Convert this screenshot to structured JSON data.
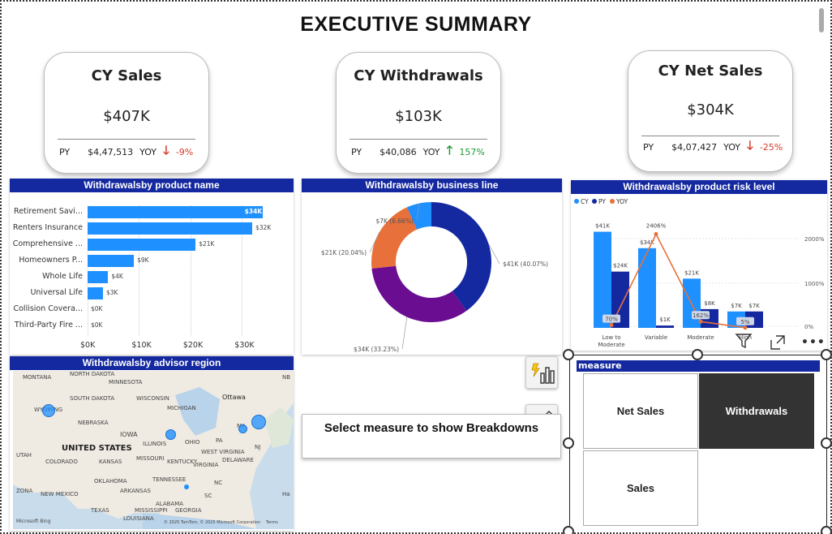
{
  "title": "EXECUTIVE SUMMARY",
  "kpis": [
    {
      "title": "CY Sales",
      "value": "$407K",
      "py_label": "PY",
      "py_value": "$4,47,513",
      "yoy_label": "YOY",
      "yoy": "-9%",
      "trend": "down"
    },
    {
      "title": "CY Withdrawals",
      "value": "$103K",
      "py_label": "PY",
      "py_value": "$40,086",
      "yoy_label": "YOY",
      "yoy": "157%",
      "trend": "up"
    },
    {
      "title": "CY Net Sales",
      "value": "$304K",
      "py_label": "PY",
      "py_value": "$4,07,427",
      "yoy_label": "YOY",
      "yoy": "-25%",
      "trend": "down"
    }
  ],
  "bar_panel": {
    "title": "Withdrawalsby product name",
    "x_ticks": [
      "$0K",
      "$10K",
      "$20K",
      "$30K"
    ]
  },
  "donut_panel": {
    "title": "Withdrawalsby business line"
  },
  "combo_panel": {
    "title": "Withdrawalsby product risk level",
    "legend": [
      "CY",
      "PY",
      "YOY"
    ],
    "right_ticks": [
      "2000%",
      "1000%",
      "0%"
    ]
  },
  "map_panel": {
    "title": "Withdrawalsby advisor region",
    "labels": [
      "MONTANA",
      "NORTH DAKOTA",
      "MINNESOTA",
      "SOUTH DAKOTA",
      "WYOMING",
      "WISCONSIN",
      "MICHIGAN",
      "Ottawa",
      "NEBRASKA",
      "IOWA",
      "UNITED STATES",
      "ILLINOIS",
      "OHIO",
      "PA",
      "NY",
      "NJ",
      "UTAH",
      "COLORADO",
      "KANSAS",
      "MISSOURI",
      "KENTUCKY",
      "WEST VIRGINIA",
      "DELAWARE",
      "VIRGINIA",
      "OKLAHOMA",
      "TENNESSEE",
      "NC",
      "ZONA",
      "NEW MEXICO",
      "ARKANSAS",
      "SC",
      "ALABAMA",
      "GEORGIA",
      "TEXAS",
      "MISSISSIPPI",
      "LOUISIANA",
      "NB",
      "Ha",
      "Microsoft Bing",
      "© 2025 TomTom, © 2025 Microsoft Corporation",
      "Terms"
    ]
  },
  "textbox": {
    "text": "Select measure to show Breakdowns"
  },
  "slicer": {
    "title": "measure",
    "options": [
      "Net Sales",
      "Withdrawals",
      "Sales"
    ],
    "selected": "Withdrawals"
  },
  "colors": {
    "header_blue": "#1428a0",
    "bar_blue": "#1e90ff",
    "navy": "#1428a0",
    "purple": "#6a0d91",
    "orange": "#e8703a",
    "yoy_orange": "#e8703a",
    "down": "#d43a2c",
    "up": "#1b9b36"
  },
  "chart_data": [
    {
      "type": "bar",
      "title": "Withdrawalsby product name",
      "categories": [
        "Retirement Savi...",
        "Renters Insurance",
        "Comprehensive ...",
        "Homeowners P...",
        "Whole Life",
        "Universal Life",
        "Collision Covera...",
        "Third-Party Fire ..."
      ],
      "values": [
        34,
        32,
        21,
        9,
        4,
        3,
        0,
        0
      ],
      "labels": [
        "$34K",
        "$32K",
        "$21K",
        "$9K",
        "$4K",
        "$3K",
        "$0K",
        "$0K"
      ],
      "xlim": [
        0,
        35
      ],
      "orientation": "horizontal"
    },
    {
      "type": "pie",
      "title": "Withdrawalsby business line",
      "slices": [
        {
          "label": "$41K (40.07%)",
          "value": 40.07,
          "color": "#1428a0"
        },
        {
          "label": "$34K (33.23%)",
          "value": 33.23,
          "color": "#6a0d91"
        },
        {
          "label": "$21K (20.04%)",
          "value": 20.04,
          "color": "#e8703a"
        },
        {
          "label": "$7K (6.66%)",
          "value": 6.66,
          "color": "#1e90ff"
        }
      ]
    },
    {
      "type": "bar",
      "title": "Withdrawalsby product risk level",
      "categories": [
        "Low to Moderate",
        "Variable",
        "Moderate",
        "High"
      ],
      "series": [
        {
          "name": "CY",
          "values": [
            41,
            34,
            21,
            7
          ],
          "labels": [
            "$41K",
            "$34K",
            "$21K",
            "$7K"
          ]
        },
        {
          "name": "PY",
          "values": [
            24,
            1,
            8,
            7
          ],
          "labels": [
            "$24K",
            "$1K",
            "$8K",
            "$7K"
          ]
        },
        {
          "name": "YOY",
          "values": [
            70,
            2406,
            162,
            5
          ],
          "labels": [
            "70%",
            "2406%",
            "162%",
            "5%"
          ]
        }
      ],
      "ylim": [
        0,
        45
      ]
    }
  ]
}
